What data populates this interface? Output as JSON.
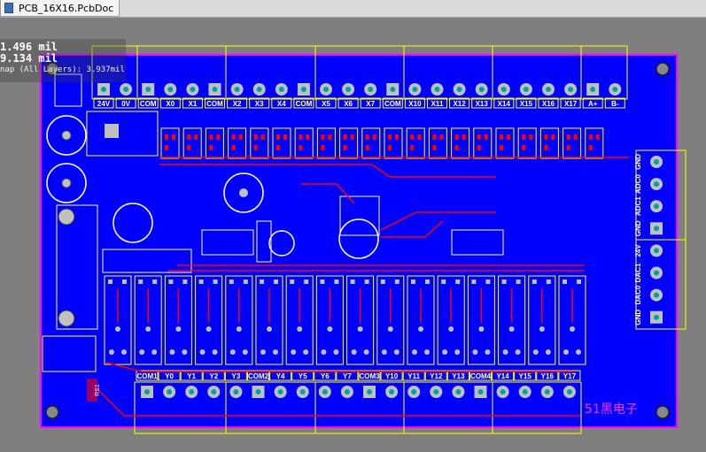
{
  "tab": {
    "title": "PCB_16X16.PcbDoc",
    "icon": "pcb-document-icon"
  },
  "hud": {
    "x": "1.496 mil",
    "y": "9.134 mil",
    "snap": "nap (All Layers): 3.937mil"
  },
  "board": {
    "top_labels": [
      "24V",
      "0V",
      "COM",
      "X0",
      "X1",
      "COM",
      "X2",
      "X3",
      "X4",
      "COM",
      "X5",
      "X6",
      "X7",
      "COM",
      "X10",
      "X11",
      "X12",
      "X13",
      "X14",
      "X15",
      "X16",
      "X17",
      "A+",
      "B-"
    ],
    "bottom_labels": [
      "COM1",
      "Y0",
      "Y1",
      "Y2",
      "Y3",
      "COM2",
      "Y4",
      "Y5",
      "Y6",
      "Y7",
      "COM3",
      "Y10",
      "Y11",
      "Y12",
      "Y13",
      "COM4",
      "Y14",
      "Y15",
      "Y16",
      "Y17"
    ],
    "right_labels": [
      "GND",
      "ADC0",
      "ADC1",
      "GND",
      "24V",
      "DAC1",
      "DAC0",
      "GND"
    ],
    "brand": "51黑电子",
    "left_small": "RS1",
    "colors": {
      "board": "#0000ff",
      "keepout": "#ff00ff",
      "overlay": "#ffff00",
      "pad": "#c0c0c0",
      "pad_hole": "#00a0a0",
      "top_trace": "#ff0000",
      "canvas": "#7f7f7f"
    }
  }
}
